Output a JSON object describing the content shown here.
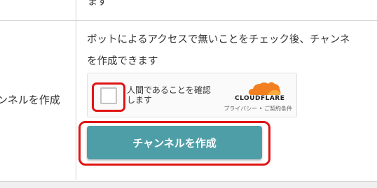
{
  "top_row": {
    "text_fragment": "ます"
  },
  "create_row": {
    "label": "ンネルを作成",
    "description_line1": "ボットによるアクセスで無いことをチェック後、チャンネ",
    "description_line2": "を作成できます"
  },
  "captcha": {
    "checkbox_label": "人間であることを確認します",
    "brand": "CLOUDFLARE",
    "privacy_link": "プライバシー",
    "separator": "•",
    "terms_link": "ご契約条件",
    "brand_color": "#f38020"
  },
  "create_button": {
    "label": "チャンネルを作成",
    "color": "#4e9ea8"
  },
  "highlight_color": "#e01414"
}
